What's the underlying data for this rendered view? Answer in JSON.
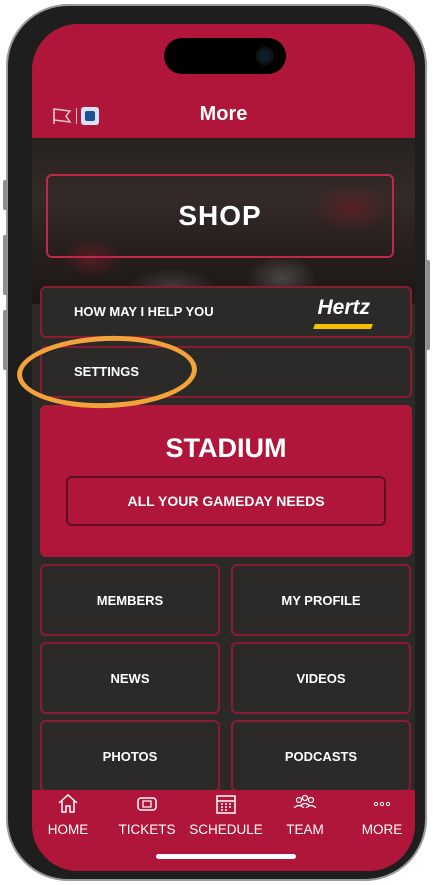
{
  "header": {
    "title": "More"
  },
  "hero": {
    "label": "SHOP"
  },
  "rows": [
    {
      "label": "HOW MAY I HELP YOU",
      "sponsor": "Hertz"
    },
    {
      "label": "SETTINGS"
    }
  ],
  "stadium": {
    "title": "STADIUM",
    "button": "ALL YOUR GAMEDAY NEEDS"
  },
  "tiles": [
    "MEMBERS",
    "MY PROFILE",
    "NEWS",
    "VIDEOS",
    "PHOTOS",
    "PODCASTS"
  ],
  "tabs": [
    {
      "label": "HOME",
      "icon": "home-icon"
    },
    {
      "label": "TICKETS",
      "icon": "ticket-icon"
    },
    {
      "label": "SCHEDULE",
      "icon": "calendar-icon"
    },
    {
      "label": "TEAM",
      "icon": "team-icon"
    },
    {
      "label": "MORE",
      "icon": "more-icon"
    }
  ],
  "colors": {
    "brand_red": "#b0163a",
    "dark_bg": "#2c2a29",
    "highlight": "#f2a33a",
    "hertz_yellow": "#f2c200"
  }
}
